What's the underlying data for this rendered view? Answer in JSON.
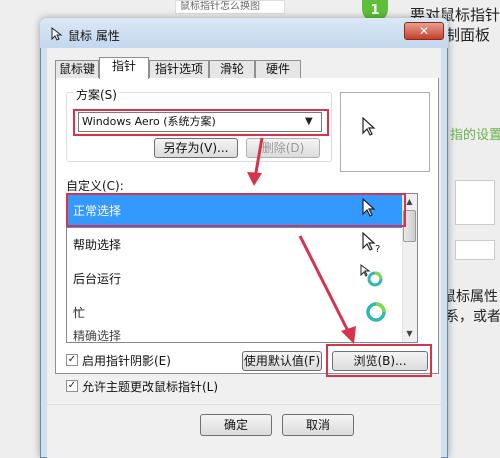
{
  "background": {
    "top_bar": "鼠标指针怎么换图",
    "step_number": "1",
    "text_line1": "要对鼠标指针",
    "text_line2": "控制面板",
    "link_fragment": "指的设置",
    "text_line3": "鼠标属性",
    "text_line4": "系，或者"
  },
  "dialog": {
    "title": "鼠标 属性",
    "close_glyph": "✕",
    "tabs": [
      {
        "label": "鼠标键"
      },
      {
        "label": "指针"
      },
      {
        "label": "指针选项"
      },
      {
        "label": "滑轮"
      },
      {
        "label": "硬件"
      }
    ],
    "scheme": {
      "label": "方案(S)",
      "selected": "Windows Aero (系统方案)",
      "save_as": "另存为(V)...",
      "delete": "删除(D)"
    },
    "customize": {
      "label": "自定义(C):",
      "items": [
        {
          "label": "正常选择"
        },
        {
          "label": "帮助选择"
        },
        {
          "label": "后台运行"
        },
        {
          "label": "忙"
        },
        {
          "label": "精确选择"
        }
      ]
    },
    "options": {
      "enable_shadow": "启用指针阴影(E)",
      "allow_theme": "允许主题更改鼠标指针(L)",
      "check_glyph": "✓"
    },
    "buttons": {
      "use_default": "使用默认值(F)",
      "browse": "浏览(B)...",
      "ok": "确定",
      "cancel": "取消"
    },
    "colors": {
      "highlight": "#3399ff",
      "annotation_red": "#d6334c"
    }
  }
}
